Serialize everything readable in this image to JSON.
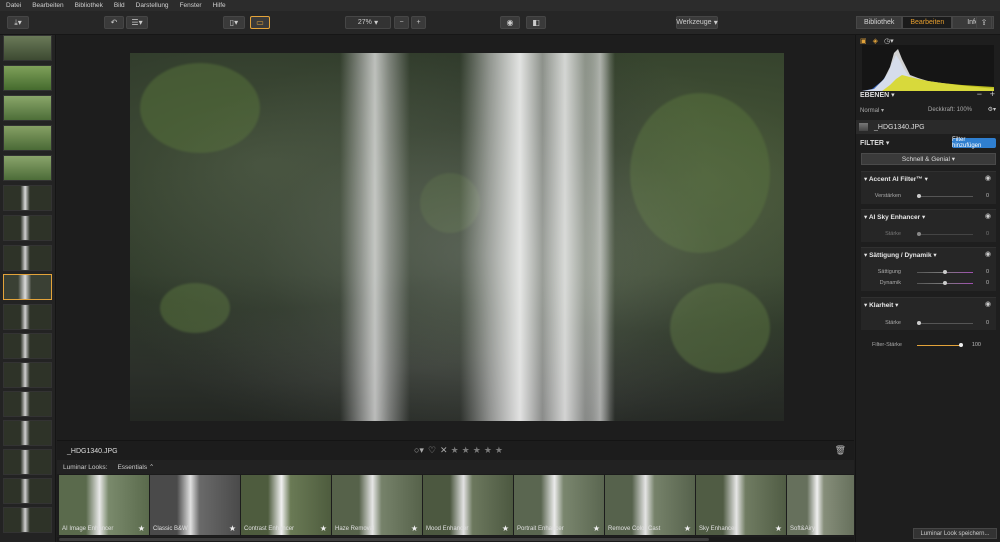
{
  "menu": [
    "Datei",
    "Bearbeiten",
    "Bibliothek",
    "Bild",
    "Darstellung",
    "Fenster",
    "Hilfe"
  ],
  "toolbar": {
    "zoom": "27%",
    "zoom_minus": "−",
    "zoom_plus": "+",
    "tools_label": "Werkzeuge",
    "tabs": [
      "Bibliothek",
      "Bearbeiten",
      "Info"
    ]
  },
  "image": {
    "filename": "_HDG1340.JPG"
  },
  "rating": {
    "stars": 0,
    "max": 5
  },
  "looks": {
    "label": "Luminar Looks:",
    "collection": "Essentials",
    "items": [
      "AI Image Enhancer",
      "Classic B&W",
      "Contrast Enhancer",
      "Haze Removal",
      "Mood Enhancer",
      "Portrait Enhancer",
      "Remove Color Cast",
      "Sky Enhancer",
      "Soft&Airy"
    ]
  },
  "panel": {
    "layers_title": "EBENEN",
    "blend_mode": "Normal",
    "opacity_label": "Deckkraft: 100%",
    "layer_name": "_HDG1340.JPG",
    "filter_title": "FILTER",
    "add_filter": "Filter hinzufügen",
    "preset_group": "Schnell & Genial",
    "filters": [
      {
        "name": "Accent AI Filter™",
        "sliders": [
          {
            "label": "Verstärken",
            "value": "0"
          }
        ]
      },
      {
        "name": "AI Sky Enhancer",
        "sliders": [
          {
            "label": "Stärke",
            "value": "0"
          }
        ]
      },
      {
        "name": "Sättigung / Dynamik",
        "sliders": [
          {
            "label": "Sättigung",
            "value": "0"
          },
          {
            "label": "Dynamik",
            "value": "0"
          }
        ]
      },
      {
        "name": "Klarheit",
        "sliders": [
          {
            "label": "Stärke",
            "value": "0"
          }
        ]
      }
    ],
    "filter_strength_label": "Filter-Stärke",
    "filter_strength_value": "100",
    "save_look": "Luminar Look speichern..."
  },
  "colors": {
    "accent_orange": "#e3a33a",
    "accent_blue": "#2f7fd0"
  }
}
